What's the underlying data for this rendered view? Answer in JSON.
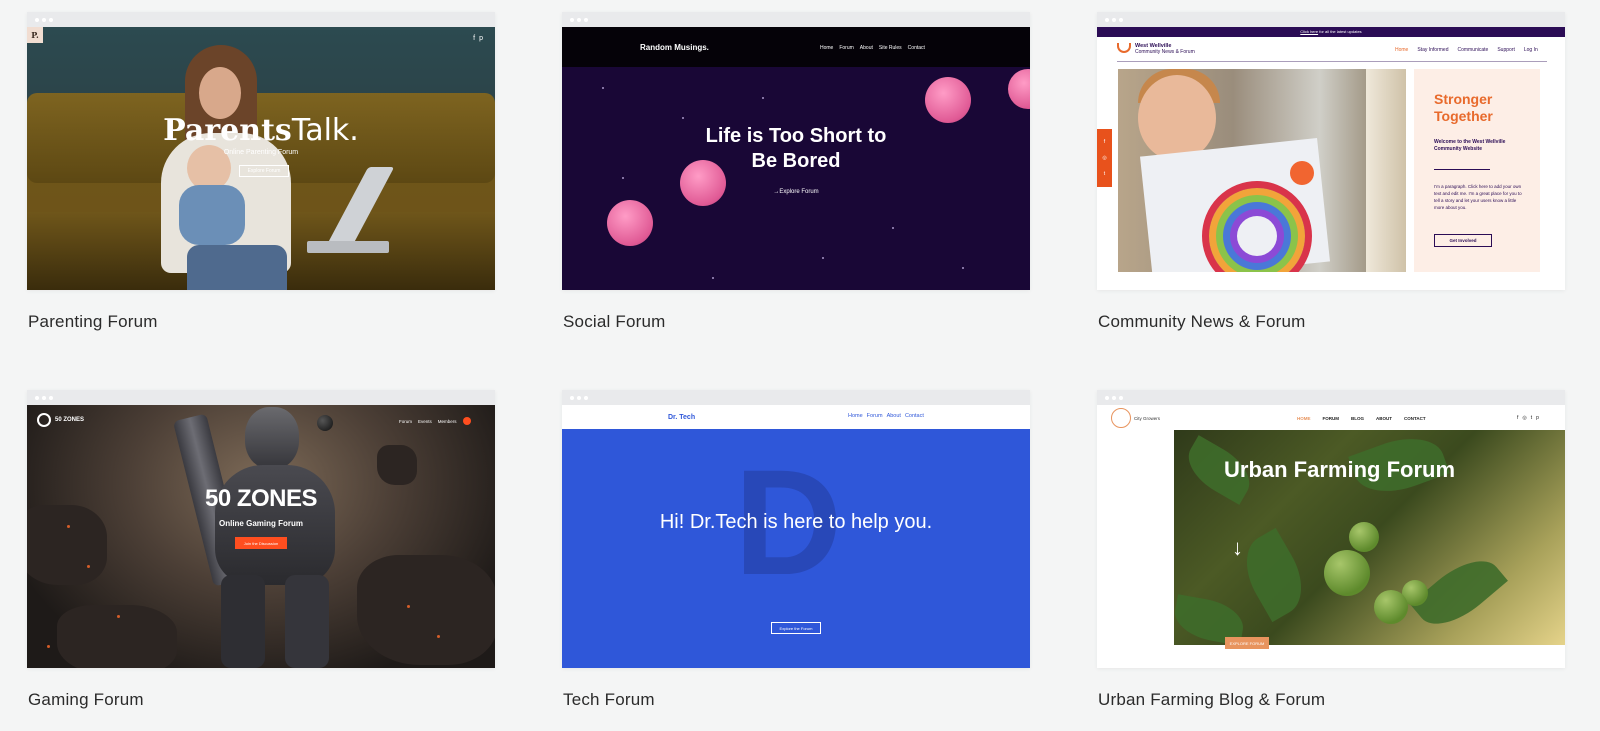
{
  "cards": [
    {
      "title": "Parenting Forum",
      "preview": {
        "logo": "P.",
        "social": [
          "f",
          "p"
        ],
        "headline_bold": "Parents",
        "headline_light": "Talk.",
        "subtitle": "Online Parenting Forum",
        "button": "Explore Forum"
      }
    },
    {
      "title": "Social Forum",
      "preview": {
        "brand": "Random Musings.",
        "nav": [
          "Home",
          "Forum",
          "About",
          "Site Rules",
          "Contact"
        ],
        "headline": "Life is Too Short to Be Bored",
        "cta": "→Explore Forum",
        "moon_color": "#f07ab0"
      }
    },
    {
      "title": "Community News & Forum",
      "preview": {
        "announcement_link": "Click here",
        "announcement_rest": " for all the latest updates",
        "brand_name": "West Wellville",
        "brand_sub": "Community News & Forum",
        "nav": [
          "Home",
          "Stay Informed",
          "Communicate",
          "Support",
          "Log In"
        ],
        "panel_title": "Stronger Together",
        "welcome": "Welcome to the West Wellville Community Website",
        "paragraph": "I'm a paragraph. Click here to add your own text and edit me. I'm a great place for you to tell a story and let your users know a little more about you.",
        "button": "Get Involved",
        "accent": "#e86a2c"
      }
    },
    {
      "title": "Gaming Forum",
      "preview": {
        "logo": "50 ZONES",
        "nav": [
          "Forum",
          "Events",
          "Members"
        ],
        "headline": "50 ZONES",
        "subtitle": "Online Gaming Forum",
        "button": "Join the Discussion",
        "accent": "#ff4e1f"
      }
    },
    {
      "title": "Tech Forum",
      "preview": {
        "brand": "Dr. Tech",
        "nav": [
          "Home",
          "Forum",
          "About",
          "Contact"
        ],
        "big_letter": "D",
        "headline": "Hi! Dr.Tech is here to help you.",
        "button": "Explore the Forum",
        "accent": "#2f57d9"
      }
    },
    {
      "title": "Urban Farming Blog & Forum",
      "preview": {
        "logo": "City Growers",
        "nav": [
          "HOME",
          "FORUM",
          "BLOG",
          "ABOUT",
          "CONTACT"
        ],
        "social": [
          "f",
          "◎",
          "t",
          "p"
        ],
        "headline": "Urban Farming Forum",
        "arrow": "↓",
        "button": "EXPLORE FORUM",
        "accent": "#e8945e"
      }
    }
  ]
}
